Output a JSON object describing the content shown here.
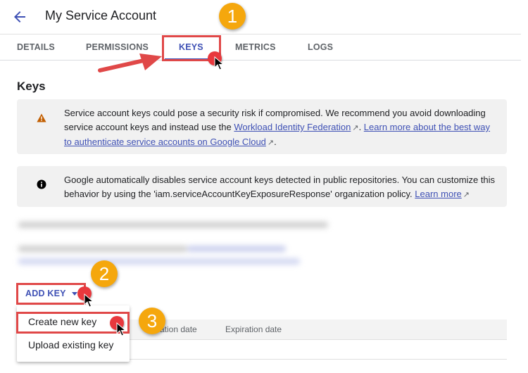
{
  "header": {
    "back_icon": "arrow-left-icon",
    "title": "My Service Account"
  },
  "tabs": [
    {
      "label": "DETAILS",
      "active": false
    },
    {
      "label": "PERMISSIONS",
      "active": false
    },
    {
      "label": "KEYS",
      "active": true
    },
    {
      "label": "METRICS",
      "active": false
    },
    {
      "label": "LOGS",
      "active": false
    }
  ],
  "section": {
    "title": "Keys"
  },
  "notices": {
    "warning": {
      "icon": "warning-icon",
      "text_1": "Service account keys could pose a security risk if compromised. We recommend you avoid downloading service account keys and instead use the ",
      "link_1": "Workload Identity Federation",
      "text_2": ". ",
      "link_2": "Learn more about the best way to authenticate service accounts on Google Cloud",
      "text_3": "."
    },
    "info": {
      "icon": "info-icon",
      "text_1": "Google automatically disables service account keys detected in public repositories. You can customize this behavior by using the 'iam.serviceAccountKeyExposureResponse' organization policy. ",
      "link_1": "Learn more"
    },
    "external_link_glyph": "↗"
  },
  "add_key": {
    "label": "ADD KEY"
  },
  "dropdown_menu": {
    "items": [
      {
        "label": "Create new key"
      },
      {
        "label": "Upload existing key"
      }
    ]
  },
  "table": {
    "columns": [
      "Creation date",
      "Expiration date"
    ],
    "visible_column_fragment": "ation date"
  },
  "annotations": {
    "steps": [
      "1",
      "2",
      "3"
    ],
    "highlight_color": "#e04848",
    "badge_color": "#f5a70d",
    "click_dot_color": "#e8383d"
  },
  "colors": {
    "accent": "#3f51b5",
    "warning": "#c25e00",
    "notice_bg": "#f1f1f1"
  }
}
